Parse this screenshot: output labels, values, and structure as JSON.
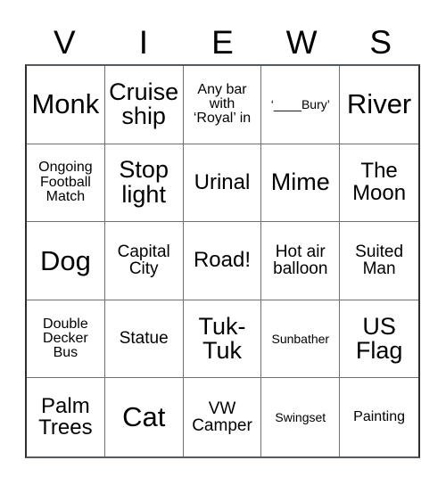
{
  "card": {
    "title_letters": [
      "V",
      "I",
      "E",
      "W",
      "S"
    ],
    "grid": {
      "columns": 5,
      "rows": 5,
      "cells": [
        {
          "label": "Monk",
          "size": "fs-xl"
        },
        {
          "label": "Cruise\nship",
          "size": "fs-lg"
        },
        {
          "label": "Any bar\nwith\n‘Royal’ in",
          "size": "fs-xs"
        },
        {
          "label": "‘____Bury’",
          "size": "fs-xxs"
        },
        {
          "label": "River",
          "size": "fs-xl"
        },
        {
          "label": "Ongoing\nFootball\nMatch",
          "size": "fs-xs"
        },
        {
          "label": "Stop\nlight",
          "size": "fs-lg"
        },
        {
          "label": "Urinal",
          "size": "fs-md"
        },
        {
          "label": "Mime",
          "size": "fs-lg"
        },
        {
          "label": "The\nMoon",
          "size": "fs-md"
        },
        {
          "label": "Dog",
          "size": "fs-xl"
        },
        {
          "label": "Capital\nCity",
          "size": "fs-sm"
        },
        {
          "label": "Road!",
          "size": "fs-md"
        },
        {
          "label": "Hot air\nballoon",
          "size": "fs-sm"
        },
        {
          "label": "Suited\nMan",
          "size": "fs-sm"
        },
        {
          "label": "Double\nDecker\nBus",
          "size": "fs-xs"
        },
        {
          "label": "Statue",
          "size": "fs-sm"
        },
        {
          "label": "Tuk-\nTuk",
          "size": "fs-lg"
        },
        {
          "label": "Sunbather",
          "size": "fs-xxs"
        },
        {
          "label": "US\nFlag",
          "size": "fs-lg"
        },
        {
          "label": "Palm\nTrees",
          "size": "fs-md"
        },
        {
          "label": "Cat",
          "size": "fs-xl"
        },
        {
          "label": "VW\nCamper",
          "size": "fs-sm"
        },
        {
          "label": "Swingset",
          "size": "fs-xxs"
        },
        {
          "label": "Painting",
          "size": "fs-xs"
        }
      ]
    },
    "colors": {
      "background": "#ffffff",
      "text": "#000000",
      "grid_line": "#6e7174",
      "grid_border": "#2b2f31"
    }
  }
}
